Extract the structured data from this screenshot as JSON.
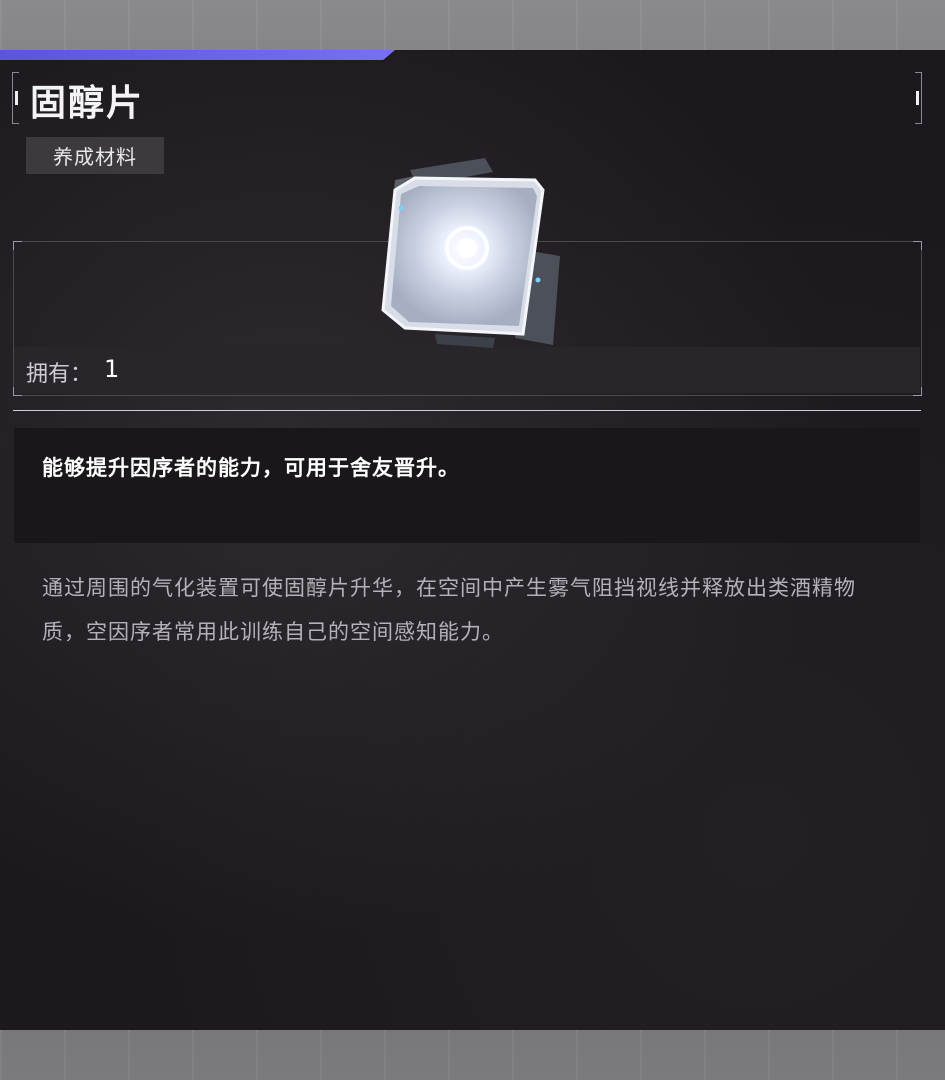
{
  "item": {
    "name": "固醇片",
    "category_tag": "养成材料",
    "owned_label": "拥有：",
    "owned_count": "1",
    "effect": "能够提升因序者的能力，可用于舍友晋升。",
    "lore": "通过周围的气化装置可使固醇片升华，在空间中产生雾气阻挡视线并释放出类酒精物质，空因序者常用此训练自己的空间感知能力。",
    "icon": "sterol-tablet-icon"
  },
  "colors": {
    "accent": "#6b66e8",
    "panel": "#1c181d",
    "tag_bg": "#3d3a3f"
  }
}
